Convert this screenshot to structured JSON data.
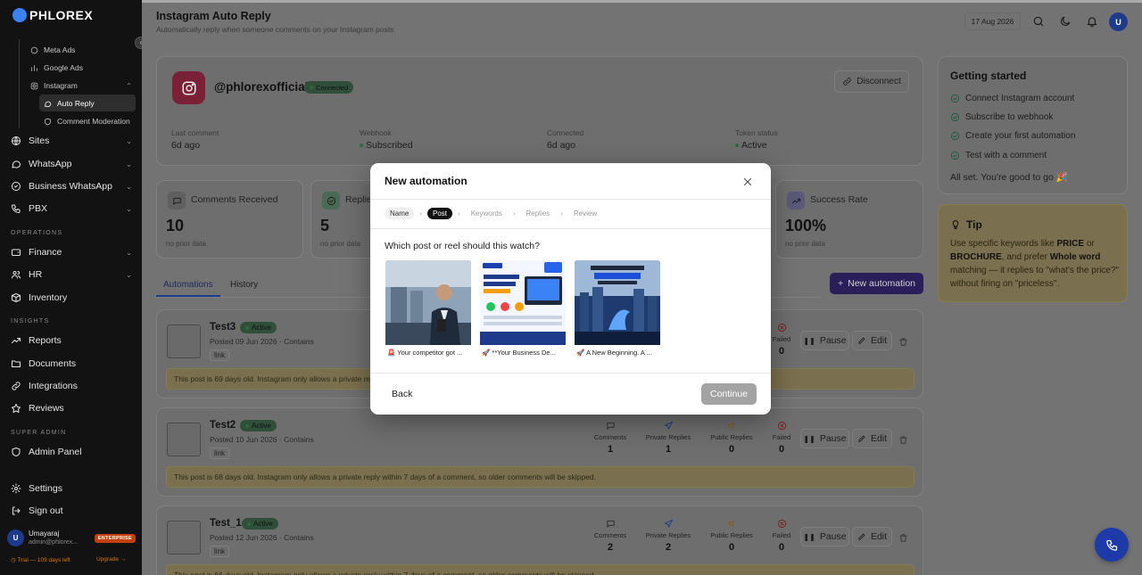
{
  "app": {
    "logo": "PHLOREX"
  },
  "sidebar": {
    "sub_items": [
      {
        "label": "Meta Ads",
        "icon": "circle-icon"
      },
      {
        "label": "Google Ads",
        "icon": "chart-icon"
      },
      {
        "label": "Instagram",
        "icon": "instagram-icon"
      },
      {
        "label": "Auto Reply",
        "icon": "chat-icon"
      },
      {
        "label": "Comment Moderation",
        "icon": "shield-icon"
      }
    ],
    "nav_items": [
      {
        "label": "Sites",
        "icon": "globe-icon"
      },
      {
        "label": "WhatsApp",
        "icon": "chat-icon"
      },
      {
        "label": "Business WhatsApp",
        "icon": "briefcase-icon"
      },
      {
        "label": "PBX",
        "icon": "phone-icon"
      }
    ],
    "operations_heading": "OPERATIONS",
    "operations_items": [
      {
        "label": "Finance",
        "icon": "wallet-icon"
      },
      {
        "label": "HR",
        "icon": "users-icon"
      },
      {
        "label": "Inventory",
        "icon": "box-icon"
      }
    ],
    "insights_heading": "INSIGHTS",
    "insights_items": [
      {
        "label": "Reports",
        "icon": "trend-icon"
      },
      {
        "label": "Documents",
        "icon": "folder-icon"
      },
      {
        "label": "Integrations",
        "icon": "link-icon"
      },
      {
        "label": "Reviews",
        "icon": "star-icon"
      }
    ],
    "superadmin_heading": "SUPER ADMIN",
    "admin_panel": "Admin Panel",
    "settings": "Settings",
    "signout": "Sign out",
    "user": {
      "initial": "U",
      "name": "Umayaraj",
      "email": "admin@phlorex...",
      "plan": "ENTERPRISE"
    },
    "trial_text": "◷ Trial — 109 days left",
    "upgrade_text": "Upgrade →"
  },
  "header": {
    "title": "Instagram Auto Reply",
    "subtitle": "Automatically reply when someone comments on your Instagram posts",
    "date": "17 Aug 2026",
    "avatar": "U"
  },
  "account": {
    "handle": "@phlorexofficial",
    "status": "Connected",
    "disconnect_label": "Disconnect",
    "meta": [
      {
        "label": "Last comment",
        "value": "6d ago"
      },
      {
        "label": "Webhook",
        "value": "Subscribed"
      },
      {
        "label": "Connected",
        "value": "6d ago"
      },
      {
        "label": "Token status",
        "value": "Active"
      }
    ]
  },
  "stats": [
    {
      "label": "Comments Received",
      "value": "10",
      "sub": "no prior data",
      "icon": "comment-icon"
    },
    {
      "label": "Replies",
      "value": "5",
      "sub": "no prior data",
      "icon": "check-icon"
    },
    {
      "label": "Success Rate",
      "value": "100%",
      "sub": "no prior data",
      "icon": "trend-icon"
    }
  ],
  "tabs": [
    {
      "label": "Automations"
    },
    {
      "label": "History"
    }
  ],
  "new_automation_label": "New automation",
  "metric_labels": {
    "comments": "Comments",
    "private": "Private Replies",
    "public": "Public Replies",
    "failed": "Failed"
  },
  "automations": [
    {
      "name": "Test3",
      "status": "Active",
      "posted": "Posted 09 Jun 2026 · Contains",
      "keyword": "link",
      "warning": "This post is 69 days old. Instagram only allows a private reply within 7 days of a comment, so older comments will be skipped.",
      "comments": "",
      "private": "",
      "public": "",
      "failed": "0"
    },
    {
      "name": "Test2",
      "status": "Active",
      "posted": "Posted 10 Jun 2026 · Contains",
      "keyword": "link",
      "warning": "This post is 68 days old. Instagram only allows a private reply within 7 days of a comment, so older comments will be skipped.",
      "comments": "1",
      "private": "1",
      "public": "0",
      "failed": "0"
    },
    {
      "name": "Test_1",
      "status": "Active",
      "posted": "Posted 12 Jun 2026 · Contains",
      "keyword": "link",
      "warning": "This post is 66 days old. Instagram only allows a private reply within 7 days of a comment, so older comments will be skipped.",
      "comments": "2",
      "private": "2",
      "public": "0",
      "failed": "0"
    }
  ],
  "row_actions": {
    "pause": "Pause",
    "edit": "Edit"
  },
  "getting_started": {
    "title": "Getting started",
    "items": [
      {
        "label": "Connect Instagram account"
      },
      {
        "label": "Subscribe to webhook"
      },
      {
        "label": "Create your first automation"
      },
      {
        "label": "Test with a comment"
      }
    ],
    "done_text": "All set. You're good to go 🎉"
  },
  "tip": {
    "title": "Tip",
    "p1": "Use specific keywords like ",
    "k1": "PRICE",
    "p2": " or ",
    "k2": "BROCHURE",
    "p3": ", and prefer ",
    "k3": "Whole word",
    "p4": " matching — it replies to \"what's the price?\" without firing on \"priceless\"."
  },
  "modal": {
    "title": "New automation",
    "steps": [
      {
        "label": "Name",
        "state": "done"
      },
      {
        "label": "Post",
        "state": "current"
      },
      {
        "label": "Keywords",
        "state": "todo"
      },
      {
        "label": "Replies",
        "state": "todo"
      },
      {
        "label": "Review",
        "state": "todo"
      }
    ],
    "question": "Which post or reel should this watch?",
    "posts": [
      {
        "caption": "🚨 Your competitor got ..."
      },
      {
        "caption": "🚀 **Your Business De..."
      },
      {
        "caption": "🚀 A New Beginning. A ..."
      }
    ],
    "back_label": "Back",
    "continue_label": "Continue"
  },
  "colors": {
    "accent": "#1e3a8a",
    "active_green": "#2d6b3e",
    "warning_bg": "#7a6f4e",
    "sidebar_bg": "#121212"
  }
}
